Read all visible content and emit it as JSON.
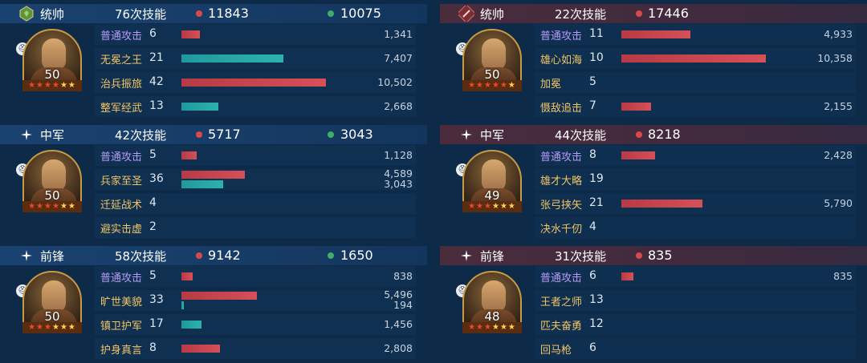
{
  "colors": {
    "damage": "#d84a4a",
    "heal": "#3fae67",
    "heal_bar": "#2cb2ae",
    "skill_name": "#f1c466",
    "basic_attack_name": "#b69af5",
    "ally_header": "#1a4270",
    "enemy_header": "#4a2c3d"
  },
  "sides": [
    {
      "side": "ally",
      "max_value": 10502,
      "bar_max_value": 10502,
      "units": [
        {
          "role": "统帅",
          "role_icon": "shield-gem-icon",
          "skills_used": "76次技能",
          "damage_total": "11843",
          "heal_total": "10075",
          "level": "50",
          "stars_red": 4,
          "stars_gold": 2,
          "skills": [
            {
              "name": "普通攻击",
              "basic": true,
              "count": "6",
              "damage": 1341,
              "damage_text": "1,341"
            },
            {
              "name": "无冕之王",
              "count": "21",
              "heal": 7407,
              "heal_text": "7,407"
            },
            {
              "name": "治兵振旅",
              "count": "42",
              "damage": 10502,
              "damage_text": "10,502"
            },
            {
              "name": "整军经武",
              "count": "13",
              "heal": 2668,
              "heal_text": "2,668"
            }
          ]
        },
        {
          "role": "中军",
          "role_icon": "sparkle-icon",
          "skills_used": "42次技能",
          "damage_total": "5717",
          "heal_total": "3043",
          "level": "50",
          "stars_red": 4,
          "stars_gold": 2,
          "skills": [
            {
              "name": "普通攻击",
              "basic": true,
              "count": "5",
              "damage": 1128,
              "damage_text": "1,128"
            },
            {
              "name": "兵家至圣",
              "count": "36",
              "damage": 4589,
              "damage_text": "4,589",
              "heal": 3043,
              "heal_text": "3,043"
            },
            {
              "name": "迁延战术",
              "count": "4"
            },
            {
              "name": "避实击虚",
              "count": "2"
            }
          ]
        },
        {
          "role": "前锋",
          "role_icon": "sparkle-icon",
          "skills_used": "58次技能",
          "damage_total": "9142",
          "heal_total": "1650",
          "level": "50",
          "stars_red": 3,
          "stars_gold": 3,
          "skills": [
            {
              "name": "普通攻击",
              "basic": true,
              "count": "5",
              "damage": 838,
              "damage_text": "838"
            },
            {
              "name": "旷世美貌",
              "count": "33",
              "damage": 5496,
              "damage_text": "5,496",
              "heal": 194,
              "heal_text": "194"
            },
            {
              "name": "镇卫护军",
              "count": "17",
              "heal": 1456,
              "heal_text": "1,456"
            },
            {
              "name": "护身真言",
              "count": "8",
              "damage": 2808,
              "damage_text": "2,808"
            }
          ]
        }
      ]
    },
    {
      "side": "enemy",
      "max_value": 10358,
      "bar_max_value": 10358,
      "units": [
        {
          "role": "统帅",
          "role_icon": "sword-icon",
          "skills_used": "22次技能",
          "damage_total": "17446",
          "heal_total": "",
          "level": "50",
          "stars_red": 5,
          "stars_gold": 1,
          "skills": [
            {
              "name": "普通攻击",
              "basic": true,
              "count": "11",
              "damage": 4933,
              "damage_text": "4,933"
            },
            {
              "name": "雄心如海",
              "count": "10",
              "damage": 10358,
              "damage_text": "10,358"
            },
            {
              "name": "加冕",
              "count": "5"
            },
            {
              "name": "慑敌追击",
              "count": "7",
              "damage": 2155,
              "damage_text": "2,155"
            }
          ]
        },
        {
          "role": "中军",
          "role_icon": "sparkle-icon",
          "skills_used": "44次技能",
          "damage_total": "8218",
          "heal_total": "",
          "level": "49",
          "stars_red": 3,
          "stars_gold": 3,
          "skills": [
            {
              "name": "普通攻击",
              "basic": true,
              "count": "8",
              "damage": 2428,
              "damage_text": "2,428"
            },
            {
              "name": "雄才大略",
              "count": "19"
            },
            {
              "name": "张弓挟矢",
              "count": "21",
              "damage": 5790,
              "damage_text": "5,790"
            },
            {
              "name": "决水千仞",
              "count": "4"
            }
          ]
        },
        {
          "role": "前锋",
          "role_icon": "sparkle-icon",
          "skills_used": "31次技能",
          "damage_total": "835",
          "heal_total": "",
          "level": "48",
          "stars_red": 3,
          "stars_gold": 3,
          "skills": [
            {
              "name": "普通攻击",
              "basic": true,
              "count": "6",
              "damage": 835,
              "damage_text": "835"
            },
            {
              "name": "王者之师",
              "count": "13"
            },
            {
              "name": "匹夫奋勇",
              "count": "12"
            },
            {
              "name": "回马枪",
              "count": "6"
            }
          ]
        }
      ]
    }
  ]
}
